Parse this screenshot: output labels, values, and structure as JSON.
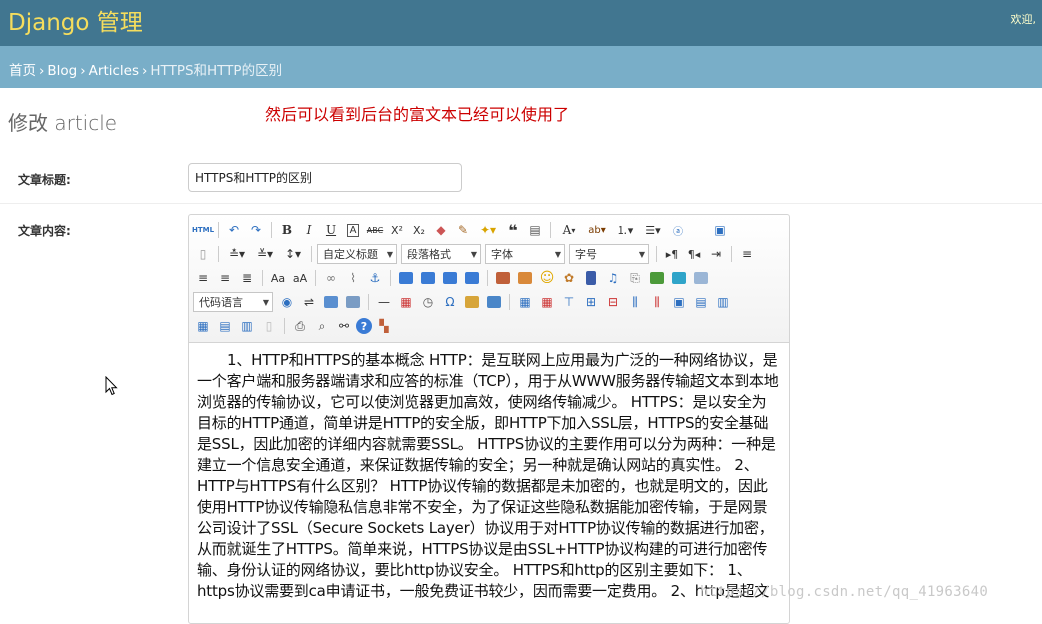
{
  "header": {
    "branding": "Django 管理",
    "user_tools": "欢迎,"
  },
  "breadcrumbs": {
    "home": "首页",
    "app": "Blog",
    "model": "Articles",
    "current": "HTTPS和HTTP的区别",
    "separator": "›"
  },
  "page": {
    "title": "修改 article",
    "annotation": "然后可以看到后台的富文本已经可以使用了"
  },
  "form": {
    "title_label": "文章标题:",
    "title_value": "HTTPS和HTTP的区别",
    "content_label": "文章内容:"
  },
  "editor": {
    "toolbar": {
      "html_label": "HTML",
      "bold": "B",
      "italic": "I",
      "underline": "U",
      "strike": "ABC",
      "custom_title": "自定义标题",
      "paragraph_format": "段落格式",
      "font_family": "字体",
      "font_size": "字号",
      "code_language": "代码语言",
      "font_color_label": "A"
    },
    "content": "1、HTTP和HTTPS的基本概念 HTTP：是互联网上应用最为广泛的一种网络协议，是一个客户端和服务器端请求和应答的标准（TCP），用于从WWW服务器传输超文本到本地浏览器的传输协议，它可以使浏览器更加高效，使网络传输减少。 HTTPS：是以安全为目标的HTTP通道，简单讲是HTTP的安全版，即HTTP下加入SSL层，HTTPS的安全基础是SSL，因此加密的详细内容就需要SSL。 HTTPS协议的主要作用可以分为两种：一种是建立一个信息安全通道，来保证数据传输的安全；另一种就是确认网站的真实性。 2、HTTP与HTTPS有什么区别？ HTTP协议传输的数据都是未加密的，也就是明文的，因此使用HTTP协议传输隐私信息非常不安全，为了保证这些隐私数据能加密传输，于是网景公司设计了SSL（Secure Sockets Layer）协议用于对HTTP协议传输的数据进行加密，从而就诞生了HTTPS。简单来说，HTTPS协议是由SSL+HTTP协议构建的可进行加密传输、身份认证的网络协议，要比http协议安全。 HTTPS和http的区别主要如下： 1、https协议需要到ca申请证书，一般免费证书较少，因而需要一定费用。 2、http是超文"
  },
  "watermark": "https://blog.csdn.net/qq_41963640"
}
